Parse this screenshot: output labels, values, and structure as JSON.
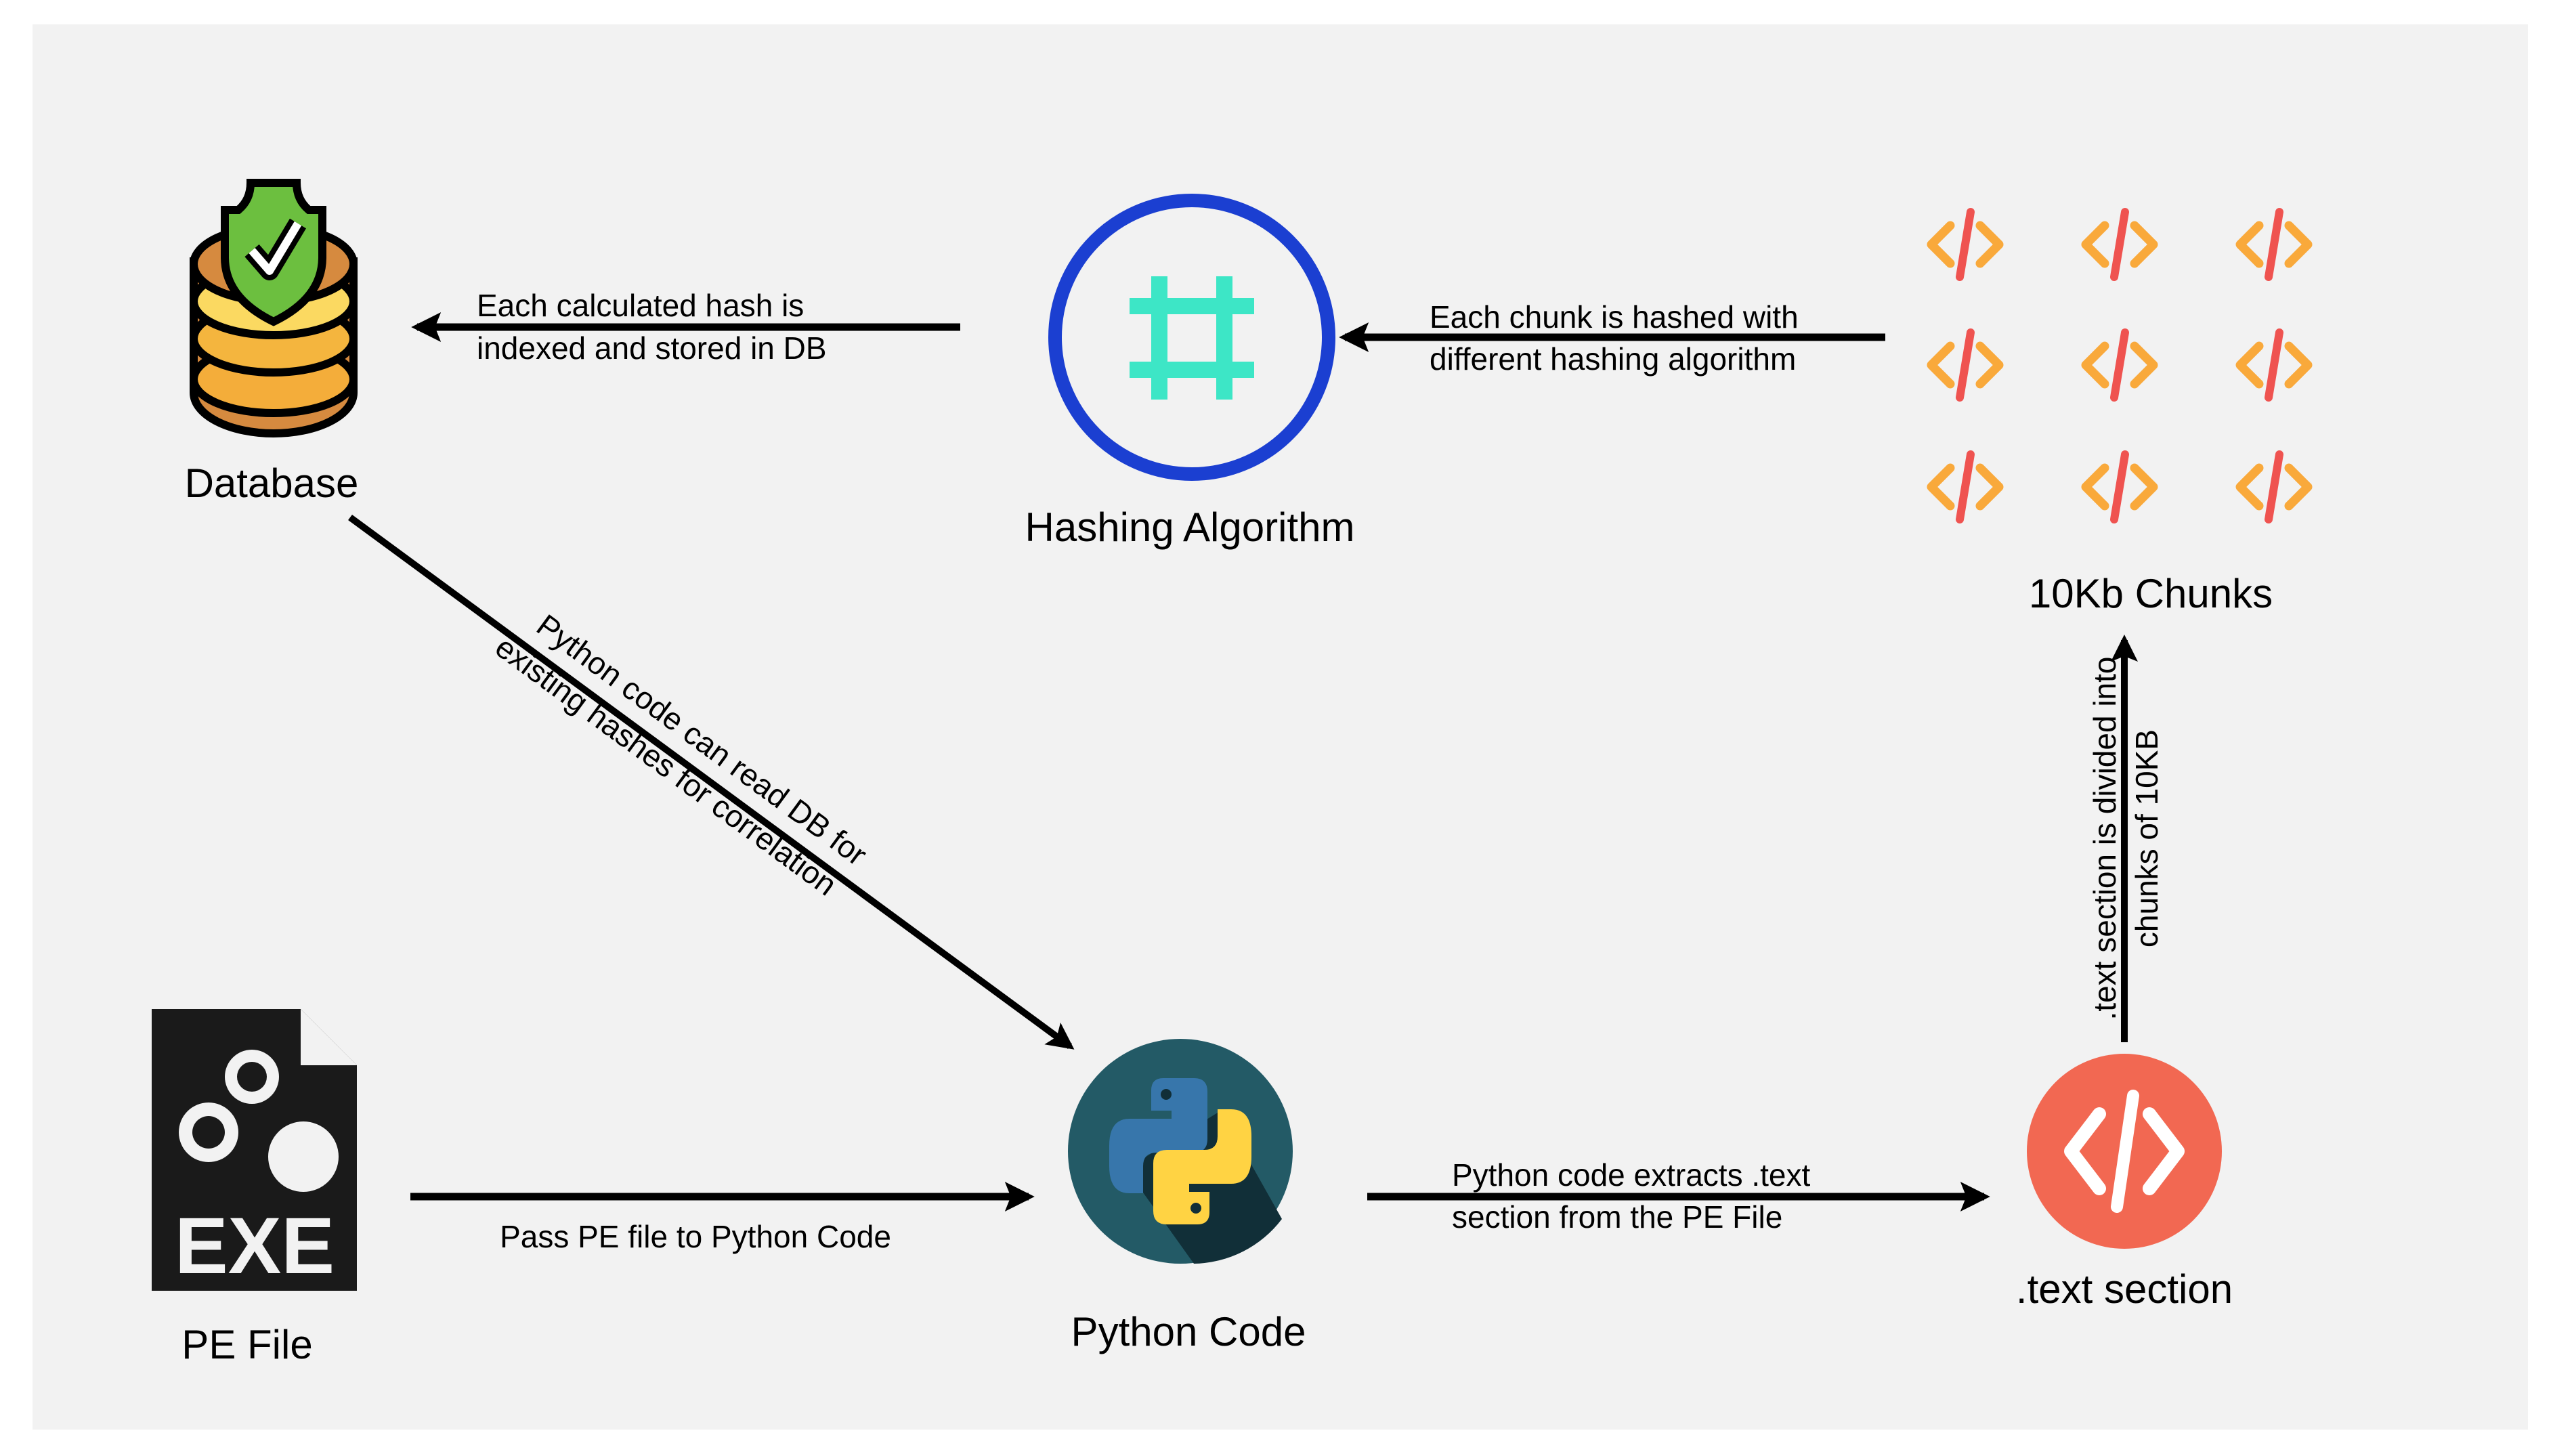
{
  "colors": {
    "background": "#f2f2f2",
    "hash_ring": "#1b3fd1",
    "hash_symbol": "#3de6c6",
    "chunk_bracket": "#f9a93b",
    "chunk_slash": "#ef5350",
    "text_section": "#f26852",
    "python_bg": "#235a66",
    "python_blue": "#3776ab",
    "python_yellow": "#ffd343"
  },
  "nodes": {
    "database": {
      "label": "Database",
      "icon": "database-shield-check-icon"
    },
    "hashing": {
      "label": "Hashing Algorithm",
      "icon": "hash-icon"
    },
    "chunks": {
      "label": "10Kb Chunks",
      "icon": "code-tag-icon"
    },
    "text_section": {
      "label": ".text section",
      "icon": "code-tag-icon"
    },
    "python": {
      "label": "Python Code",
      "icon": "python-logo-icon"
    },
    "pe_file": {
      "label": "PE File",
      "icon": "exe-file-icon",
      "icon_text": "EXE"
    }
  },
  "edges": {
    "hash_to_db": {
      "line1": "Each calculated hash is",
      "line2": "indexed and stored in DB"
    },
    "chunks_to_hash": {
      "line1": "Each chunk is  hashed with",
      "line2": "different hashing algorithm"
    },
    "text_to_chunks": {
      "line1": ".text section is divided into",
      "line2": "chunks of 10KB"
    },
    "python_to_text": {
      "line1": "Python code extracts .text",
      "line2": "section from the PE File"
    },
    "pe_to_python": {
      "line1": "Pass PE file to Python Code"
    },
    "db_to_python": {
      "line1": "Python code can read DB for",
      "line2": "existing hashes for correlation"
    }
  }
}
